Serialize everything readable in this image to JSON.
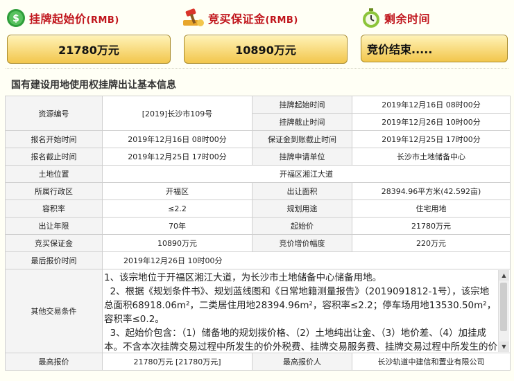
{
  "header": {
    "start_price_label": "挂牌起始价",
    "start_price_unit": "(RMB)",
    "deposit_label": "竞买保证金",
    "deposit_unit": "(RMB)",
    "remaining_label": "剩余时间"
  },
  "summary": {
    "start_price": "21780万元",
    "deposit": "10890万元",
    "status": "竞价结束....."
  },
  "section_title": "国有建设用地使用权挂牌出让基本信息",
  "fields": {
    "resource_no_k": "资源编号",
    "resource_no_v": "[2019]长沙市109号",
    "listing_start_k": "挂牌起始时间",
    "listing_start_v": "2019年12月16日 08时00分",
    "listing_end_k": "挂牌截止时间",
    "listing_end_v": "2019年12月26日 10时00分",
    "reg_start_k": "报名开始时间",
    "reg_start_v": "2019年12月16日 08时00分",
    "deposit_deadline_k": "保证金到账截止时间",
    "deposit_deadline_v": "2019年12月25日 17时00分",
    "reg_end_k": "报名截止时间",
    "reg_end_v": "2019年12月25日 17时00分",
    "applicant_k": "挂牌申请单位",
    "applicant_v": "长沙市土地储备中心",
    "location_k": "土地位置",
    "location_v": "开福区湘江大道",
    "district_k": "所属行政区",
    "district_v": "开福区",
    "area_k": "出让面积",
    "area_v": "28394.96平方米(42.592亩)",
    "far_k": "容积率",
    "far_v": "≤2.2",
    "usage_k": "规划用途",
    "usage_v": "住宅用地",
    "term_k": "出让年限",
    "term_v": "70年",
    "start_price_k": "起始价",
    "start_price_v": "21780万元",
    "deposit_k": "竞买保证金",
    "deposit_v": "10890万元",
    "increment_k": "竞价增价幅度",
    "increment_v": "220万元",
    "last_bid_time_k": "最后报价时间",
    "last_bid_time_v": "2019年12月26日 10时00分",
    "other_k": "其他交易条件",
    "other_v": "1、该宗地位于开福区湘江大道，为长沙市土地储备中心储备用地。\n  2、根据《规划条件书》、规划蓝线图和《日常地籍测量报告》（2019091812-1号），该宗地总面积68918.06m²，二类居住用地28394.96m²，容积率≤2.2；停车场用地13530.50m²，容积率≤0.2。\n  3、起始价包含：（1）储备地的规划拨价格、（2）土地纯出让金、（3）地价差、（4）加挂成本。不含本次挂牌交易过程中所发生的价外税费、挂牌交易服务费、挂牌交易过程中所发生的价外税费、挂牌交易服务费由竞买人按规定交纳。",
    "highest_bid_k": "最高报价",
    "highest_bid_v": "21780万元 [21780万元]",
    "highest_bidder_k": "最高报价人",
    "highest_bidder_v": "长沙轨道中建信和置业有限公司"
  },
  "colors": {
    "accent_red": "#c0141b",
    "box_top": "#fff3b8",
    "box_bottom": "#f2c64c"
  },
  "icons": {
    "start_price": "money-coin-icon",
    "deposit": "bid-hammer-icon",
    "remaining": "stopwatch-icon"
  }
}
